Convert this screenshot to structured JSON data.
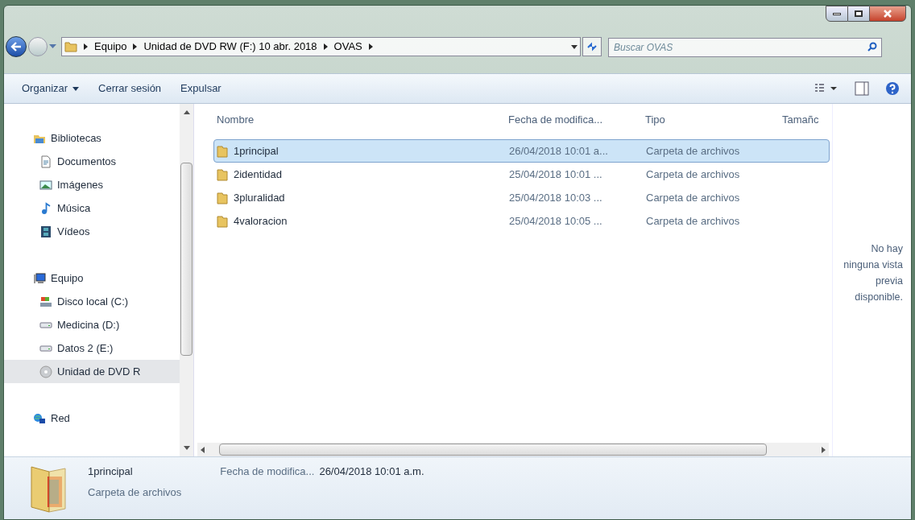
{
  "address_bar": {
    "crumbs": [
      "Equipo",
      "Unidad de DVD RW (F:) 10 abr. 2018",
      "OVAS"
    ]
  },
  "search": {
    "placeholder": "Buscar OVAS"
  },
  "toolbar": {
    "buttons": [
      {
        "label": "Organizar",
        "dropdown": true
      },
      {
        "label": "Cerrar sesión",
        "dropdown": false
      },
      {
        "label": "Expulsar",
        "dropdown": false
      }
    ]
  },
  "sidebar": {
    "groups": [
      {
        "label": "Bibliotecas",
        "kind": "library",
        "selected": false,
        "children": [
          {
            "label": "Documentos",
            "kind": "documents",
            "selected": false
          },
          {
            "label": "Imágenes",
            "kind": "pictures",
            "selected": false
          },
          {
            "label": "Música",
            "kind": "music",
            "selected": false
          },
          {
            "label": "Vídeos",
            "kind": "videos",
            "selected": false
          }
        ]
      },
      {
        "label": "Equipo",
        "kind": "computer",
        "selected": false,
        "children": [
          {
            "label": "Disco local (C:)",
            "kind": "system-disk",
            "selected": false
          },
          {
            "label": "Medicina (D:)",
            "kind": "drive",
            "selected": false
          },
          {
            "label": "Datos 2 (E:)",
            "kind": "drive",
            "selected": false
          },
          {
            "label": "Unidad de DVD R",
            "kind": "dvd",
            "selected": true
          }
        ]
      },
      {
        "label": "Red",
        "kind": "network",
        "selected": false
      }
    ]
  },
  "table": {
    "columns": [
      "Nombre",
      "Fecha de modifica...",
      "Tipo",
      "Tamañc"
    ],
    "rows": [
      {
        "name": "1principal",
        "date": "26/04/2018 10:01 a...",
        "type": "Carpeta de archivos",
        "selected": true
      },
      {
        "name": "2identidad",
        "date": "25/04/2018 10:01 ...",
        "type": "Carpeta de archivos",
        "selected": false
      },
      {
        "name": "3pluralidad",
        "date": "25/04/2018 10:03 ...",
        "type": "Carpeta de archivos",
        "selected": false
      },
      {
        "name": "4valoracion",
        "date": "25/04/2018 10:05 ...",
        "type": "Carpeta de archivos",
        "selected": false
      }
    ]
  },
  "preview": {
    "message": "No hay ninguna vista previa disponible."
  },
  "details": {
    "name": "1principal",
    "type": "Carpeta de archivos",
    "field_label": "Fecha de modifica...",
    "field_value": "26/04/2018 10:01 a.m."
  }
}
